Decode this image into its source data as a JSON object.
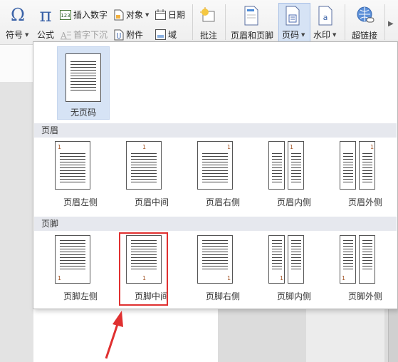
{
  "ribbon": {
    "symbol_label": "符号",
    "formula_label": "公式",
    "insert_number_label": "插入数字",
    "drop_cap_label": "首字下沉",
    "object_label": "对象",
    "attachment_label": "附件",
    "date_label": "日期",
    "field_label": "域",
    "comment_label": "批注",
    "header_footer_label": "页眉和页脚",
    "page_number_label": "页码",
    "watermark_label": "水印",
    "hyperlink_label": "超链接",
    "insert_number_icon_text": "123",
    "watermark_icon_text": "a"
  },
  "dropdown": {
    "no_page_number_label": "无页码",
    "header_section_title": "页眉",
    "footer_section_title": "页脚",
    "header_options": [
      {
        "label": "页眉左侧"
      },
      {
        "label": "页眉中间"
      },
      {
        "label": "页眉右侧"
      },
      {
        "label": "页眉内侧"
      },
      {
        "label": "页眉外侧"
      }
    ],
    "footer_options": [
      {
        "label": "页脚左侧"
      },
      {
        "label": "页脚中间"
      },
      {
        "label": "页脚右侧"
      },
      {
        "label": "页脚内侧"
      },
      {
        "label": "页脚外侧"
      }
    ],
    "page_number_sample": "1",
    "selected_option": "页脚中间"
  },
  "colors": {
    "highlight_border": "#e03030",
    "arrow": "#e03030",
    "selected_option_bg": "#d6e3f5",
    "section_header_bg": "#e6e8ee"
  }
}
